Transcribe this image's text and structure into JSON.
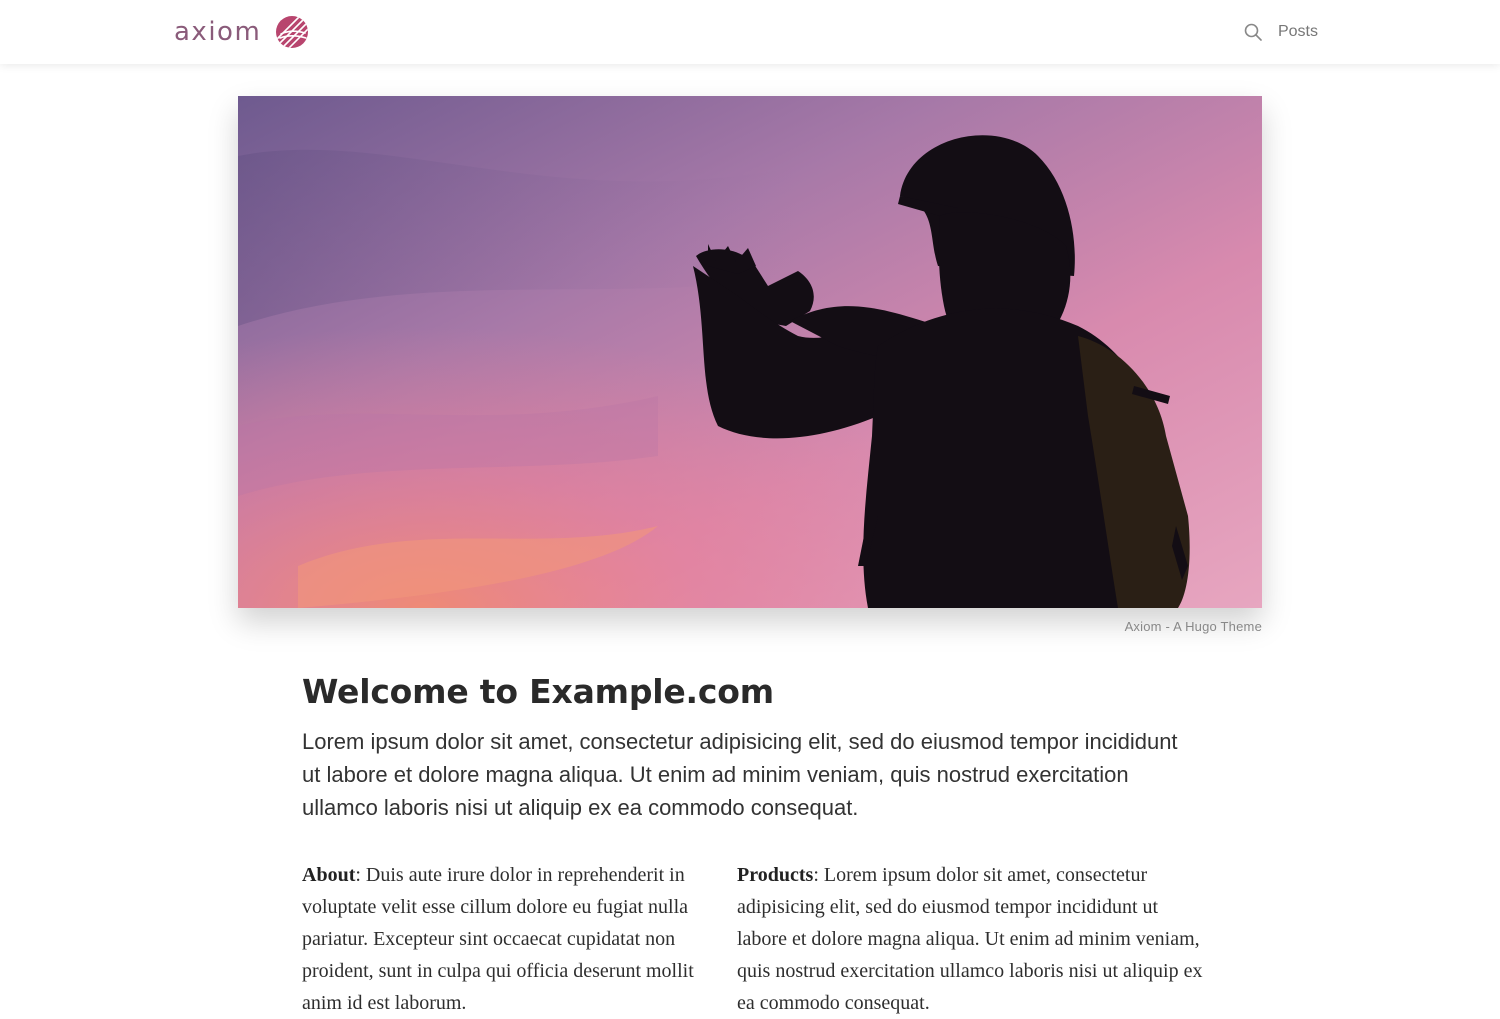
{
  "header": {
    "brand_name": "axiom",
    "brand_icon": "axiom-logo-mark",
    "brand_color": "#8a5b7a",
    "accent_color": "#b8456e",
    "search_icon": "search-icon",
    "nav": [
      {
        "label": "Posts"
      }
    ]
  },
  "hero": {
    "image_icon": "hero-photo",
    "caption": "Axiom - A Hugo Theme"
  },
  "main": {
    "title": "Welcome to Example.com",
    "lead": "Lorem ipsum dolor sit amet, consectetur adipisicing elit, sed do eiusmod tempor incididunt ut labore et dolore magna aliqua. Ut enim ad minim veniam, quis nostrud exercitation ullamco laboris nisi ut aliquip ex ea commodo consequat.",
    "columns": [
      {
        "label": "About",
        "text": ": Duis aute irure dolor in reprehenderit in voluptate velit esse cillum dolore eu fugiat nulla pariatur. Excepteur sint occaecat cupidatat non proident, sunt in culpa qui officia deserunt mollit anim id est laborum."
      },
      {
        "label": "Products",
        "text": ": Lorem ipsum dolor sit amet, consectetur adipisicing elit, sed do eiusmod tempor incididunt ut labore et dolore magna aliqua. Ut enim ad minim veniam, quis nostrud exercitation ullamco laboris nisi ut aliquip ex ea commodo consequat."
      }
    ]
  }
}
